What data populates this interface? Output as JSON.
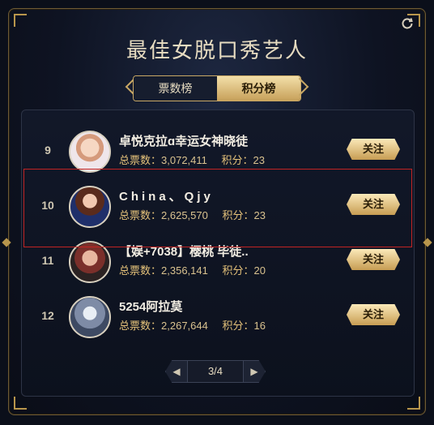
{
  "header": {
    "title": "最佳女脱口秀艺人",
    "refresh_icon": "refresh-icon"
  },
  "tabs": [
    {
      "label": "票数榜",
      "active": false
    },
    {
      "label": "积分榜",
      "active": true
    }
  ],
  "labels": {
    "votes": "总票数：",
    "points": "积分：",
    "follow": "关注"
  },
  "rows": [
    {
      "rank": "9",
      "name": "卓悦克拉ɑ幸运女神晓徒",
      "votes": "3,072,411",
      "points": "23"
    },
    {
      "rank": "10",
      "name": "China、Qjy",
      "votes": "2,625,570",
      "points": "23"
    },
    {
      "rank": "11",
      "name": "【娱+7038】樱桃 毕徒..",
      "votes": "2,356,141",
      "points": "20"
    },
    {
      "rank": "12",
      "name": "5254阿拉莫",
      "votes": "2,267,644",
      "points": "16"
    }
  ],
  "pager": {
    "text": "3/4",
    "prev_icon": "chevron-left-icon",
    "next_icon": "chevron-right-icon"
  },
  "colors": {
    "accent_gold": "#c9a865",
    "highlight_red": "#c22424"
  }
}
